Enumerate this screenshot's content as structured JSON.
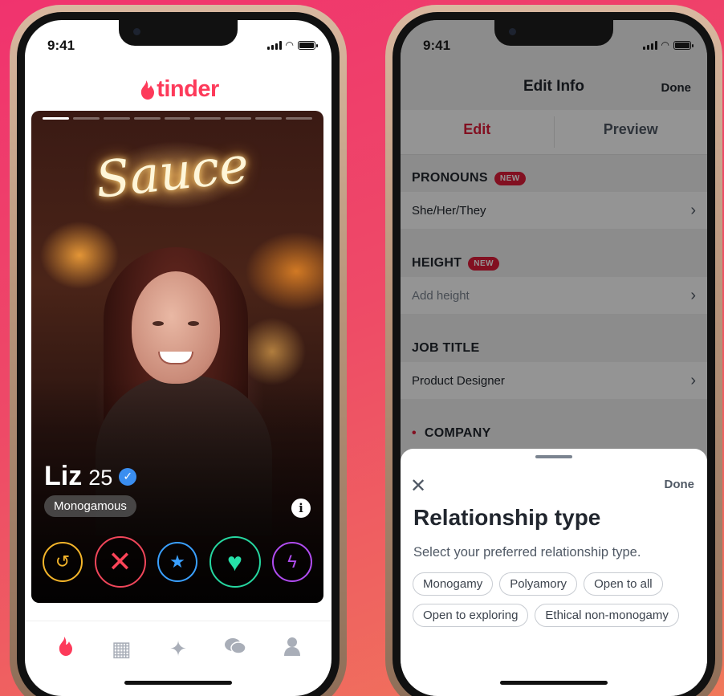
{
  "colors": {
    "brand": "#fd3a5a",
    "accent_red": "#e01c3a"
  },
  "left_phone": {
    "status_time": "9:41",
    "logo_text": "tinder",
    "card": {
      "neon_sign": "Sauce",
      "name": "Liz",
      "age": "25",
      "verified_icon": "verified-check-icon",
      "tag": "Monogamous",
      "info_icon": "i",
      "photo_count": 9,
      "current_photo": 1
    },
    "actions": [
      {
        "name": "rewind-button",
        "icon": "rewind-icon",
        "glyph": "↺"
      },
      {
        "name": "nope-button",
        "icon": "x-icon",
        "glyph": "✕"
      },
      {
        "name": "superlike-button",
        "icon": "star-icon",
        "glyph": "★"
      },
      {
        "name": "like-button",
        "icon": "heart-icon",
        "glyph": "♥"
      },
      {
        "name": "boost-button",
        "icon": "lightning-icon",
        "glyph": "ϟ"
      }
    ],
    "tabs": [
      {
        "name": "tab-home",
        "icon": "flame-icon",
        "glyph": "🔥",
        "active": true
      },
      {
        "name": "tab-explore",
        "icon": "explore-grid-icon",
        "glyph": "▦",
        "active": false
      },
      {
        "name": "tab-gold",
        "icon": "sparkle-icon",
        "glyph": "✦",
        "active": false
      },
      {
        "name": "tab-messages",
        "icon": "chat-icon",
        "glyph": "💬",
        "active": false
      },
      {
        "name": "tab-profile",
        "icon": "profile-icon",
        "glyph": "👤",
        "active": false
      }
    ]
  },
  "right_phone": {
    "status_time": "9:41",
    "nav": {
      "title": "Edit Info",
      "done": "Done"
    },
    "segments": {
      "edit": "Edit",
      "preview": "Preview"
    },
    "sections": {
      "pronouns": {
        "title": "PRONOUNS",
        "badge": "NEW",
        "value": "She/Her/They"
      },
      "height": {
        "title": "HEIGHT",
        "badge": "NEW",
        "value": "Add height"
      },
      "job_title": {
        "title": "JOB TITLE",
        "value": "Product Designer"
      },
      "company": {
        "title": "COMPANY",
        "bullet": "•"
      }
    },
    "sheet": {
      "close_icon": "✕",
      "done": "Done",
      "title": "Relationship type",
      "subtitle": "Select your preferred relationship type.",
      "options": [
        "Monogamy",
        "Polyamory",
        "Open to all",
        "Open to exploring",
        "Ethical non-monogamy"
      ]
    }
  }
}
